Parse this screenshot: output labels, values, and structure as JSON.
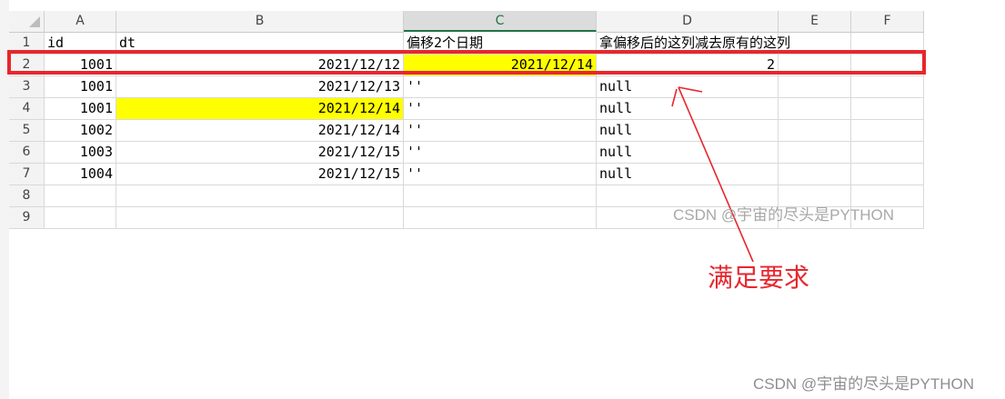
{
  "sheet": {
    "columns": [
      "A",
      "B",
      "C",
      "D",
      "E",
      "F"
    ],
    "rows": [
      {
        "num": "1",
        "A": "id",
        "B": "dt",
        "C": "偏移2个日期",
        "D": "拿偏移后的这列减去原有的这列",
        "E": "",
        "F": ""
      },
      {
        "num": "2",
        "A": "1001",
        "B": "2021/12/12",
        "C": "2021/12/14",
        "D": "2",
        "E": "",
        "F": ""
      },
      {
        "num": "3",
        "A": "1001",
        "B": "2021/12/13",
        "C": "''",
        "D": "null",
        "E": "",
        "F": ""
      },
      {
        "num": "4",
        "A": "1001",
        "B": "2021/12/14",
        "C": "''",
        "D": "null",
        "E": "",
        "F": ""
      },
      {
        "num": "5",
        "A": "1002",
        "B": "2021/12/14",
        "C": "''",
        "D": "null",
        "E": "",
        "F": ""
      },
      {
        "num": "6",
        "A": "1003",
        "B": "2021/12/15",
        "C": "''",
        "D": "null",
        "E": "",
        "F": ""
      },
      {
        "num": "7",
        "A": "1004",
        "B": "2021/12/15",
        "C": "''",
        "D": "null",
        "E": "",
        "F": ""
      },
      {
        "num": "8",
        "A": "",
        "B": "",
        "C": "",
        "D": "",
        "E": "",
        "F": ""
      },
      {
        "num": "9",
        "A": "",
        "B": "",
        "C": "",
        "D": "",
        "E": "",
        "F": ""
      }
    ]
  },
  "annotation": {
    "text": "满足要求",
    "color": "#e8262d"
  },
  "watermarks": [
    "CSDN @宇宙的尽头是PYTHON",
    "CSDN @宇宙的尽头是PYTHON"
  ],
  "colors": {
    "highlight_fill": "#ffff00",
    "selected_column_header": "#217346"
  }
}
